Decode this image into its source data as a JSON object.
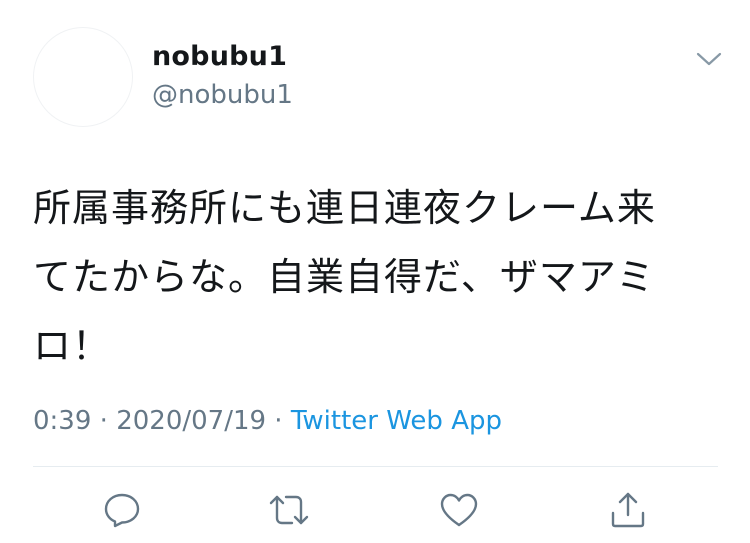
{
  "tweet": {
    "display_name": "nobubu1",
    "handle": "@nobubu1",
    "text_lines": [
      "所属事務所にも連日連夜クレーム来",
      "てたからな。自業自得だ、ザマアミ",
      "ロ！"
    ],
    "time": "0:39",
    "date": "2020/07/19",
    "separator": " · ",
    "source": "Twitter Web App"
  },
  "icons": {
    "caret": "chevron-down-icon",
    "reply": "reply-icon",
    "retweet": "retweet-icon",
    "like": "like-icon",
    "share": "share-icon"
  },
  "colors": {
    "text": "#14171a",
    "secondary": "#657786",
    "link": "#1b95e0",
    "icon": "#657786",
    "divider": "#e6ecf0"
  }
}
